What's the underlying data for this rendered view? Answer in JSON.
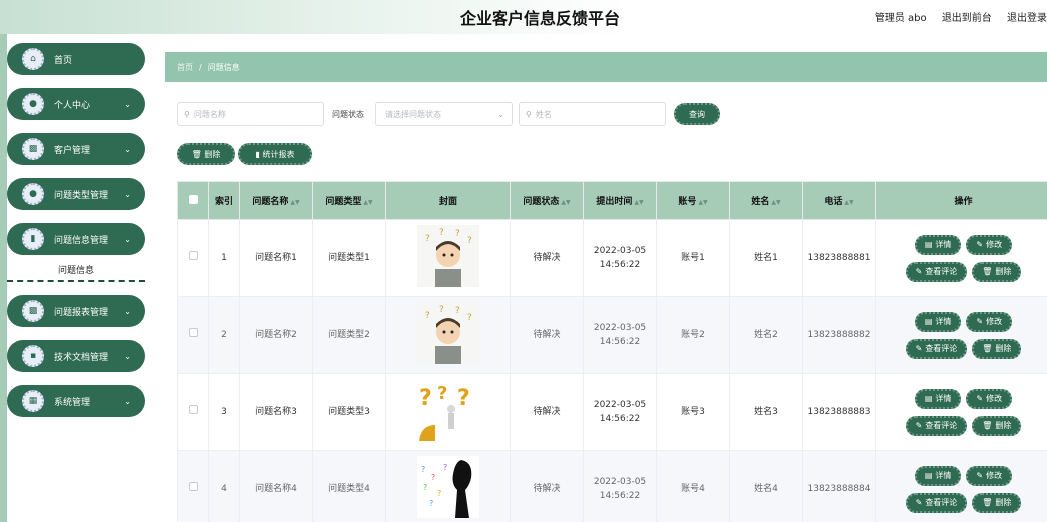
{
  "header": {
    "title": "企业客户信息反馈平台",
    "user": "管理员 abo",
    "back_label": "退出到前台",
    "logout_label": "退出登录"
  },
  "sidebar": {
    "items": [
      {
        "label": "首页",
        "icon": "home-icon",
        "has_chevron": false
      },
      {
        "label": "个人中心",
        "icon": "user-icon",
        "has_chevron": true
      },
      {
        "label": "客户管理",
        "icon": "monitor-icon",
        "has_chevron": true
      },
      {
        "label": "问题类型管理",
        "icon": "user-icon",
        "has_chevron": true
      },
      {
        "label": "问题信息管理",
        "icon": "chart-icon",
        "has_chevron": true
      },
      {
        "label": "问题报表管理",
        "icon": "chat-icon",
        "has_chevron": true
      },
      {
        "label": "技术文档管理",
        "icon": "ticket-icon",
        "has_chevron": true
      },
      {
        "label": "系统管理",
        "icon": "grid-icon",
        "has_chevron": true
      }
    ],
    "active_sub": "问题信息"
  },
  "breadcrumb": {
    "home": "首页",
    "current": "问题信息"
  },
  "search": {
    "name_placeholder": "问题名称",
    "status_label": "问题状态",
    "status_placeholder": "请选择问题状态",
    "username_placeholder": "姓名",
    "query_label": "查询"
  },
  "actions": {
    "delete_label": "删除",
    "stats_label": "统计报表"
  },
  "table": {
    "headers": [
      "索引",
      "问题名称",
      "问题类型",
      "封面",
      "问题状态",
      "提出时间",
      "账号",
      "姓名",
      "电话",
      "操作"
    ],
    "rows": [
      {
        "index": "1",
        "name": "问题名称1",
        "type": "问题类型1",
        "status": "待解决",
        "time": "2022-03-05 14:56:22",
        "account": "账号1",
        "username": "姓名1",
        "phone": "13823888881"
      },
      {
        "index": "2",
        "name": "问题名称2",
        "type": "问题类型2",
        "status": "待解决",
        "time": "2022-03-05 14:56:22",
        "account": "账号2",
        "username": "姓名2",
        "phone": "13823888882"
      },
      {
        "index": "3",
        "name": "问题名称3",
        "type": "问题类型3",
        "status": "待解决",
        "time": "2022-03-05 14:56:22",
        "account": "账号3",
        "username": "姓名3",
        "phone": "13823888883"
      },
      {
        "index": "4",
        "name": "问题名称4",
        "type": "问题类型4",
        "status": "待解决",
        "time": "2022-03-05 14:56:22",
        "account": "账号4",
        "username": "姓名4",
        "phone": "13823888884"
      }
    ],
    "op_labels": {
      "detail": "详情",
      "edit": "修改",
      "comment": "查看评论",
      "delete": "删除"
    }
  },
  "colors": {
    "primary": "#2f6a52",
    "header_bg": "#a6cbb7",
    "breadcrumb_bg": "#93c4ad"
  }
}
